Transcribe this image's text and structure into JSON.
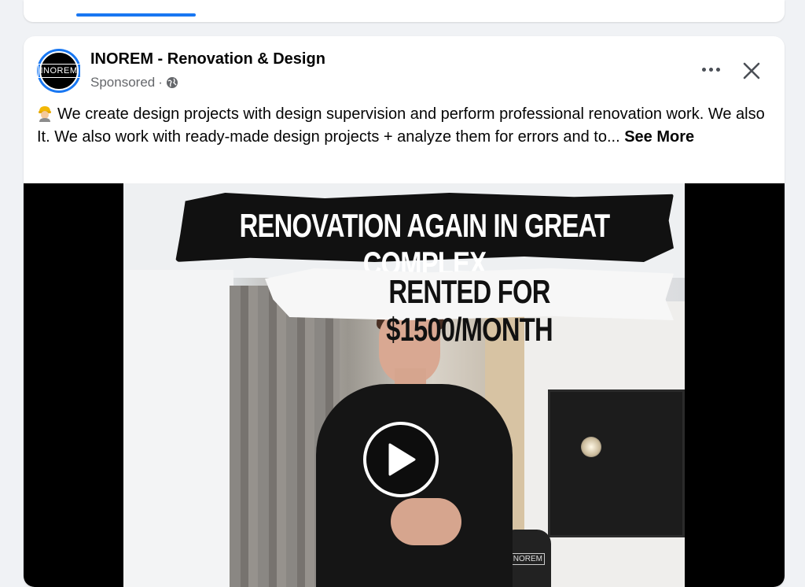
{
  "feed": {
    "active_tab_color": "#1877f2"
  },
  "post": {
    "page_name": "INOREM - Renovation & Design",
    "sponsored_label": "Sponsored",
    "separator": "·",
    "avatar_logo_text": "INOREM",
    "text": "We create design projects with design supervision and perform professional renovation work. We also It. We also work with ready-made design projects + analyze them for errors and to...",
    "see_more": "See More",
    "emoji_icon": "construction-worker-icon",
    "more_icon": "more-options-icon",
    "close_icon": "close-icon"
  },
  "video": {
    "headline_1": "RENOVATION AGAIN IN GREAT COMPLEX",
    "headline_2": "RENTED FOR $1500/MONTH",
    "chair_logo_text": "INOREM",
    "play_icon": "play-icon"
  }
}
